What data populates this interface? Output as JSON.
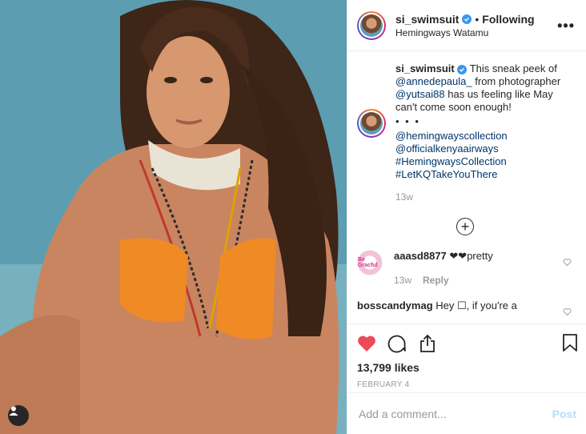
{
  "post": {
    "username": "si_swimsuit",
    "follow_sep": "•",
    "follow_status": "Following",
    "location": "Hemingways Watamu",
    "more_icon": "more-options-icon"
  },
  "caption": {
    "username": "si_swimsuit",
    "text_1": "This sneak peek of",
    "mention_1": "@annedepaula_",
    "text_2": "from photographer",
    "mention_2": "@yutsai88",
    "text_3": "has us feeling like May can't come soon enough!",
    "dots": "• • •",
    "tags": [
      "@hemingwayscollection",
      "@officialkenyaairways",
      "#HemingwaysCollection",
      "#LetKQTakeYouThere"
    ],
    "time": "13w"
  },
  "comments": [
    {
      "username": "aaasd8877",
      "text": "❤❤pretty",
      "time": "13w",
      "reply": "Reply",
      "avatar_text": "Be Gracful"
    },
    {
      "username": "bosscandymag",
      "text": "Hey ☐, if you're a"
    }
  ],
  "actions": {
    "likes": "13,799 likes",
    "date": "FEBRUARY 4"
  },
  "composer": {
    "placeholder": "Add a comment...",
    "post_label": "Post"
  },
  "colors": {
    "like_red": "#ed4956",
    "link_blue": "#003569",
    "verified_blue": "#3897f0",
    "post_disabled": "#b2dffc"
  }
}
